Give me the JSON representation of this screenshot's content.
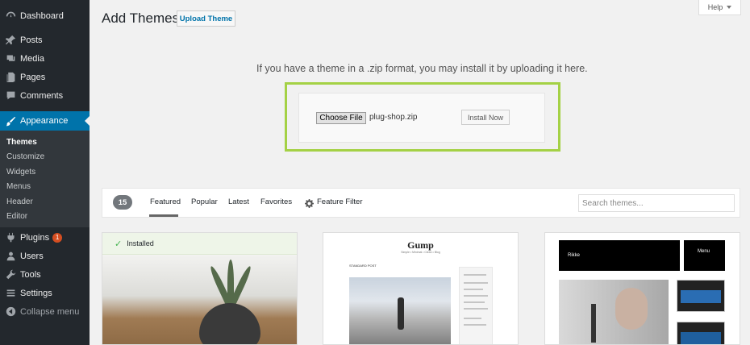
{
  "sidebar": {
    "items": [
      {
        "label": "Dashboard",
        "icon": "dashboard-icon"
      },
      {
        "label": "Posts",
        "icon": "pin-icon"
      },
      {
        "label": "Media",
        "icon": "media-icon"
      },
      {
        "label": "Pages",
        "icon": "pages-icon"
      },
      {
        "label": "Comments",
        "icon": "comment-icon"
      },
      {
        "label": "Appearance",
        "icon": "brush-icon"
      },
      {
        "label": "Plugins",
        "icon": "plug-icon",
        "badge": "1"
      },
      {
        "label": "Users",
        "icon": "users-icon"
      },
      {
        "label": "Tools",
        "icon": "wrench-icon"
      },
      {
        "label": "Settings",
        "icon": "settings-icon"
      }
    ],
    "appearance_submenu": [
      "Themes",
      "Customize",
      "Widgets",
      "Menus",
      "Header",
      "Editor"
    ],
    "collapse_label": "Collapse menu"
  },
  "header": {
    "title": "Add Themes",
    "upload_button": "Upload Theme",
    "help_button": "Help"
  },
  "upload": {
    "message": "If you have a theme in a .zip format, you may install it by uploading it here.",
    "choose_file": "Choose File",
    "file_name": "plug-shop.zip",
    "install_button": "Install Now"
  },
  "filter": {
    "count": "15",
    "tabs": [
      "Featured",
      "Popular",
      "Latest",
      "Favorites"
    ],
    "feature_filter": "Feature Filter",
    "search_placeholder": "Search themes..."
  },
  "themes": {
    "installed_label": "Installed",
    "gump_title": "Gump",
    "gump_subtitle": "Simple • Minimal • Clean • Blog",
    "gump_heading": "STANDARD POST",
    "rikke_name": "Rikke",
    "rikke_menu": "Menu"
  },
  "colors": {
    "sidebar_bg": "#23282d",
    "accent": "#0073aa",
    "highlight": "#a4d145",
    "installed_check": "#46b450"
  }
}
